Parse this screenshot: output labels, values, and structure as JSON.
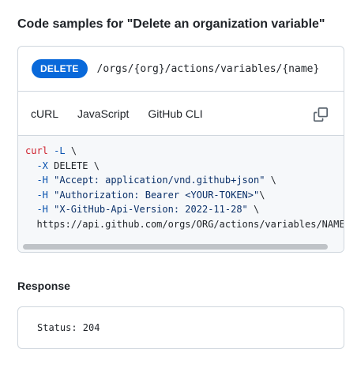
{
  "title": "Code samples for \"Delete an organization variable\"",
  "endpoint": {
    "method": "DELETE",
    "path": "/orgs/{org}/actions/variables/{name}"
  },
  "tabs": [
    {
      "label": "cURL",
      "active": true
    },
    {
      "label": "JavaScript",
      "active": false
    },
    {
      "label": "GitHub CLI",
      "active": false
    }
  ],
  "copy_icon": "copy-icon",
  "code": {
    "line1": {
      "cmd": "curl",
      "flag": " -L",
      "rest": " \\"
    },
    "line2": {
      "indent": "  ",
      "flag": "-X",
      "rest": " DELETE \\"
    },
    "line3": {
      "indent": "  ",
      "flag": "-H",
      "str": " \"Accept: application/vnd.github+json\"",
      "rest": " \\"
    },
    "line4": {
      "indent": "  ",
      "flag": "-H",
      "str": " \"Authorization: Bearer <YOUR-TOKEN>\"",
      "rest": "\\"
    },
    "line5": {
      "indent": "  ",
      "flag": "-H",
      "str": " \"X-GitHub-Api-Version: 2022-11-28\"",
      "rest": " \\"
    },
    "line6": {
      "text": "  https://api.github.com/orgs/ORG/actions/variables/NAME"
    }
  },
  "response": {
    "heading": "Response",
    "status": "Status: 204"
  },
  "colors": {
    "accent": "#0969da",
    "keyword": "#cf222e",
    "flag": "#0550ae",
    "string": "#0a3069"
  }
}
